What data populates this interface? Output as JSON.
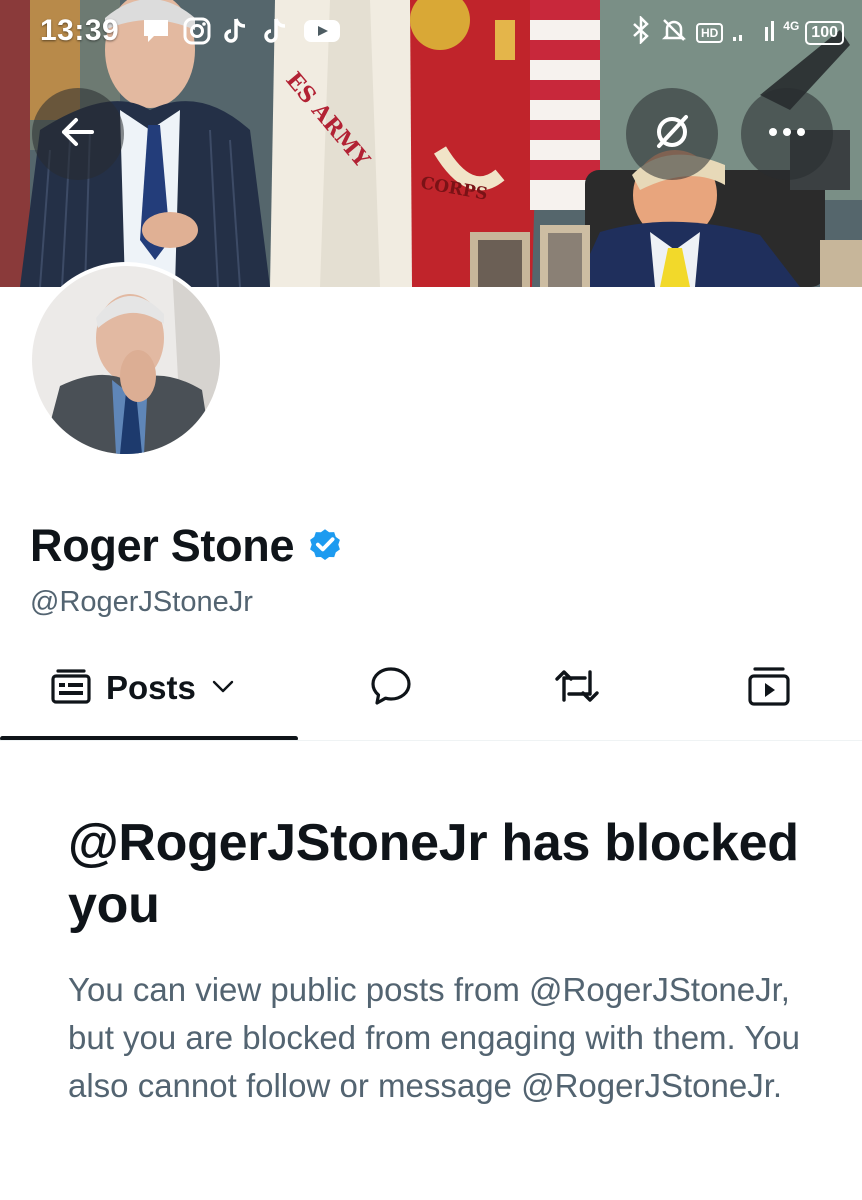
{
  "status_bar": {
    "time": "13:39",
    "network_label": "4G",
    "hd_badge": "HD",
    "battery": "100",
    "left_icons": [
      "message-icon",
      "instagram-icon",
      "tiktok-icon",
      "tiktok-icon",
      "youtube-icon"
    ],
    "right_icons": [
      "bluetooth-icon",
      "bell-off-icon",
      "hd-icon",
      "signal-icon",
      "battery-icon"
    ]
  },
  "banner": {
    "flag_text_1": "ES ARMY",
    "flag_text_2": "CORPS"
  },
  "header_buttons": {
    "back": "arrow-left-icon",
    "grok": "grok-icon",
    "more": "more-icon"
  },
  "profile": {
    "display_name": "Roger Stone",
    "handle": "@RogerJStoneJr",
    "verified": true
  },
  "tabs": {
    "posts_label": "Posts",
    "items": [
      "posts",
      "replies",
      "reposts",
      "media"
    ],
    "active": "posts"
  },
  "blocked": {
    "title": "@RogerJStoneJr has blocked you",
    "body": "You can view public posts from @RogerJStoneJr, but you are blocked from engaging with them. You also cannot follow or message @RogerJStoneJr."
  },
  "colors": {
    "verified_blue": "#1d9bf0",
    "text_primary": "#0f1419",
    "text_secondary": "#536471"
  }
}
